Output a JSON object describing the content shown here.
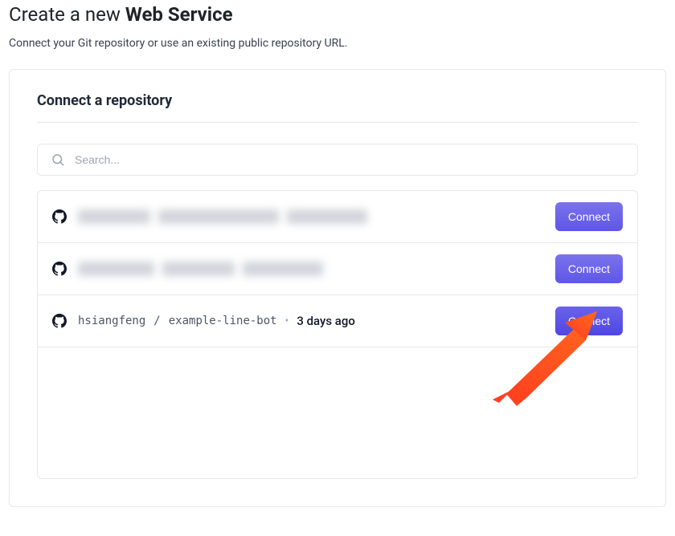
{
  "header": {
    "title_prefix": "Create a new ",
    "title_bold": "Web Service",
    "subtitle": "Connect your Git repository or use an existing public repository URL."
  },
  "section": {
    "title": "Connect a repository"
  },
  "search": {
    "placeholder": "Search..."
  },
  "repos": [
    {
      "owner": "",
      "name": "",
      "updated": "",
      "connect_label": "Connect",
      "redacted": true,
      "selected": false
    },
    {
      "owner": "",
      "name": "",
      "updated": "",
      "connect_label": "Connect",
      "redacted": true,
      "selected": false
    },
    {
      "owner": "hsiangfeng",
      "name": "example-line-bot",
      "updated": "3 days ago",
      "connect_label": "Connect",
      "redacted": false,
      "selected": true
    }
  ],
  "annotation": {
    "arrow_color": "#ff3b1f"
  }
}
